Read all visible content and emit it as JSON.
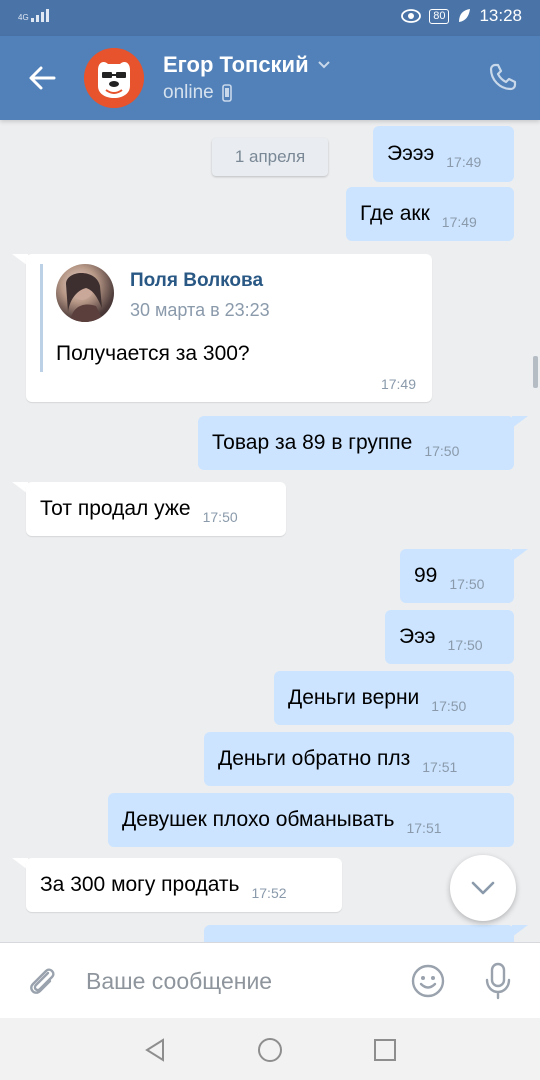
{
  "status_bar": {
    "network": "4G",
    "battery": "80",
    "time": "13:28"
  },
  "header": {
    "contact_name": "Егор Топский",
    "status": "online"
  },
  "chat": {
    "date_divider": "1 апреля",
    "messages": [
      {
        "dir": "out",
        "text": "Ээээ",
        "time": "17:49"
      },
      {
        "dir": "out",
        "text": "Где акк",
        "time": "17:49"
      },
      {
        "dir": "in",
        "forwarded": {
          "author": "Поля Волкова",
          "date": "30 марта в 23:23",
          "text": "Получается за 300?"
        },
        "time": "17:49"
      },
      {
        "dir": "out",
        "text": "Товар за 89 в группе",
        "time": "17:50"
      },
      {
        "dir": "in",
        "text": "Тот продал уже",
        "time": "17:50"
      },
      {
        "dir": "out",
        "text": "99",
        "time": "17:50"
      },
      {
        "dir": "out",
        "text": "Эээ",
        "time": "17:50"
      },
      {
        "dir": "out",
        "text": "Деньги верни",
        "time": "17:50"
      },
      {
        "dir": "out",
        "text": "Деньги обратно плз",
        "time": "17:51"
      },
      {
        "dir": "out",
        "text": "Девушек плохо обманывать",
        "time": "17:51"
      },
      {
        "dir": "in",
        "text": "За 300 могу продать",
        "time": "17:52"
      }
    ]
  },
  "composer": {
    "placeholder": "Ваше сообщение"
  },
  "colors": {
    "header": "#5181b8",
    "status_bar": "#4a74a8",
    "outgoing_bubble": "#cce4ff",
    "incoming_bubble": "#ffffff",
    "chat_background": "#edeef0"
  }
}
